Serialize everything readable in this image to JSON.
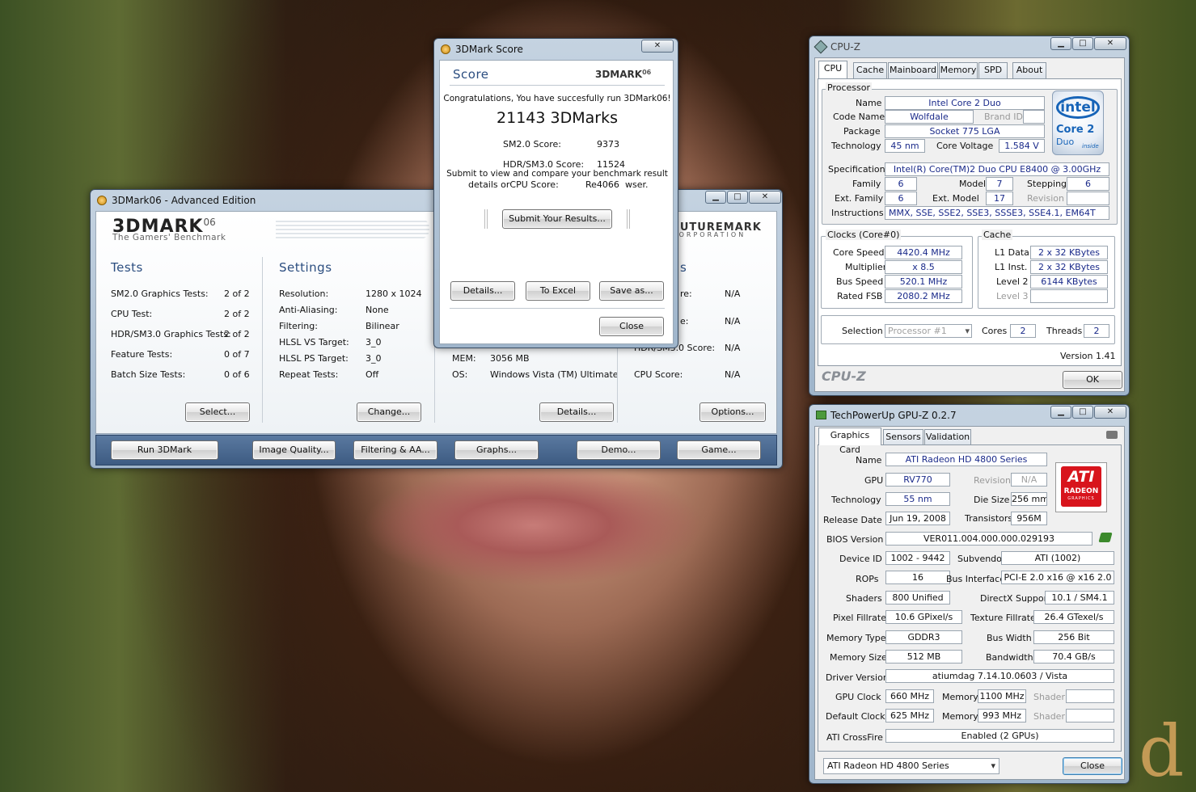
{
  "desktop": {
    "watermark": "d"
  },
  "mark3d": {
    "title": "3DMark06 - Advanced Edition",
    "logo": "3DMARK",
    "logo_sup": "06",
    "tagline": "The Gamers' Benchmark",
    "brand": "FUTUREMARK",
    "brand_sub": "CORPORATION",
    "tests": {
      "heading": "Tests",
      "rows": [
        {
          "label": "SM2.0 Graphics Tests:",
          "value": "2 of 2"
        },
        {
          "label": "CPU Test:",
          "value": "2 of 2"
        },
        {
          "label": "HDR/SM3.0 Graphics Tests:",
          "value": "2 of 2"
        },
        {
          "label": "Feature Tests:",
          "value": "0 of 7"
        },
        {
          "label": "Batch Size Tests:",
          "value": "0 of 6"
        }
      ],
      "button": "Select..."
    },
    "settings": {
      "heading": "Settings",
      "rows": [
        {
          "label": "Resolution:",
          "value": "1280 x 1024"
        },
        {
          "label": "Anti-Aliasing:",
          "value": "None"
        },
        {
          "label": "Filtering:",
          "value": "Bilinear"
        },
        {
          "label": "HLSL VS Target:",
          "value": "3_0"
        },
        {
          "label": "HLSL PS Target:",
          "value": "3_0"
        },
        {
          "label": "Repeat Tests:",
          "value": "Off"
        }
      ],
      "button": "Change..."
    },
    "system": {
      "rows": [
        {
          "label": "MEM:",
          "value": "3056 MB"
        },
        {
          "label": "OS:",
          "value": "Windows Vista (TM) Ultimate"
        }
      ],
      "button": "Details..."
    },
    "results": {
      "heading_suffix": "s",
      "rows": [
        {
          "label": "re:",
          "value": "N/A"
        },
        {
          "label": "e:",
          "value": "N/A"
        },
        {
          "label": "HDR/SM3.0 Score:",
          "value": "N/A"
        },
        {
          "label": "CPU Score:",
          "value": "N/A"
        }
      ],
      "button": "Options..."
    },
    "bottom": [
      "Run 3DMark",
      "Image Quality...",
      "Filtering & AA...",
      "Graphs...",
      "Demo...",
      "Game..."
    ]
  },
  "score": {
    "title": "3DMark Score",
    "heading": "Score",
    "logo": "3DMARK",
    "logo_sup": "06",
    "congrats": "Congratulations, You have succesfully run 3DMark06!",
    "total": "21143 3DMarks",
    "sm2_label": "SM2.0 Score:",
    "sm2_value": "9373",
    "hdr_label": "HDR/SM3.0 Score:",
    "hdr_value": "11524",
    "submit_line1": "Submit to view and compare your benchmark result",
    "submit_line2_a": "details orCPU Score:",
    "submit_line2_b": "Re4066",
    "submit_line2_c": "wser.",
    "submit_btn": "Submit Your Results...",
    "details_btn": "Details...",
    "excel_btn": "To Excel",
    "saveas_btn": "Save as...",
    "close_btn": "Close"
  },
  "cpuz": {
    "title": "CPU-Z",
    "tabs": [
      "CPU",
      "Cache",
      "Mainboard",
      "Memory",
      "SPD",
      "About"
    ],
    "processor_title": "Processor",
    "name_label": "Name",
    "name": "Intel Core 2 Duo",
    "codename_label": "Code Name",
    "codename": "Wolfdale",
    "brandid_label": "Brand ID",
    "package_label": "Package",
    "package": "Socket 775 LGA",
    "tech_label": "Technology",
    "tech": "45 nm",
    "voltage_label": "Core Voltage",
    "voltage": "1.584 V",
    "spec_label": "Specification",
    "spec": "Intel(R) Core(TM)2 Duo CPU    E8400  @ 3.00GHz",
    "family_label": "Family",
    "family": "6",
    "model_label": "Model",
    "model": "7",
    "stepping_label": "Stepping",
    "stepping": "6",
    "extfamily_label": "Ext. Family",
    "extfamily": "6",
    "extmodel_label": "Ext. Model",
    "extmodel": "17",
    "revision_label": "Revision",
    "instr_label": "Instructions",
    "instr": "MMX, SSE, SSE2, SSE3, SSSE3, SSE4.1, EM64T",
    "logo_intel": "intel",
    "logo_core": "Core 2",
    "logo_duo": "Duo",
    "logo_inside": "inside",
    "clocks_title": "Clocks (Core#0)",
    "corespeed_label": "Core Speed",
    "corespeed": "4420.4 MHz",
    "mult_label": "Multiplier",
    "mult": "x 8.5",
    "bus_label": "Bus Speed",
    "bus": "520.1 MHz",
    "fsb_label": "Rated FSB",
    "fsb": "2080.2 MHz",
    "cache_title": "Cache",
    "l1d_label": "L1 Data",
    "l1d": "2 x 32 KBytes",
    "l1i_label": "L1 Inst.",
    "l1i": "2 x 32 KBytes",
    "l2_label": "Level 2",
    "l2": "6144 KBytes",
    "l3_label": "Level 3",
    "selection_label": "Selection",
    "selection": "Processor #1",
    "cores_label": "Cores",
    "cores": "2",
    "threads_label": "Threads",
    "threads": "2",
    "version": "Version 1.41",
    "footer_logo": "CPU-Z",
    "ok": "OK"
  },
  "gpuz": {
    "title": "TechPowerUp GPU-Z 0.2.7",
    "tabs": [
      "Graphics Card",
      "Sensors",
      "Validation"
    ],
    "name_label": "Name",
    "name": "ATI Radeon HD 4800 Series",
    "gpu_label": "GPU",
    "gpu": "RV770",
    "revision_label": "Revision",
    "revision": "N/A",
    "tech_label": "Technology",
    "tech": "55 nm",
    "die_label": "Die Size",
    "die": "256 mm²",
    "release_label": "Release Date",
    "release": "Jun 19, 2008",
    "trans_label": "Transistors",
    "trans": "956M",
    "bios_label": "BIOS Version",
    "bios": "VER011.004.000.000.029193",
    "device_label": "Device ID",
    "device": "1002 - 9442",
    "subvendor_label": "Subvendor",
    "subvendor": "ATI (1002)",
    "rops_label": "ROPs",
    "rops": "16",
    "busif_label": "Bus Interface",
    "busif": "PCI-E 2.0 x16 @ x16 2.0",
    "shaders_label": "Shaders",
    "shaders": "800 Unified",
    "dx_label": "DirectX Support",
    "dx": "10.1 / SM4.1",
    "pix_label": "Pixel Fillrate",
    "pix": "10.6 GPixel/s",
    "tex_label": "Texture Fillrate",
    "tex": "26.4 GTexel/s",
    "memtype_label": "Memory Type",
    "memtype": "GDDR3",
    "buswidth_label": "Bus Width",
    "buswidth": "256 Bit",
    "memsize_label": "Memory Size",
    "memsize": "512 MB",
    "bandwidth_label": "Bandwidth",
    "bandwidth": "70.4 GB/s",
    "driver_label": "Driver Version",
    "driver": "atiumdag 7.14.10.0603  / Vista",
    "gpuclock_label": "GPU Clock",
    "gpuclock": "660 MHz",
    "mem_label": "Memory",
    "memclock": "1100 MHz",
    "shader_label": "Shader",
    "defclock_label": "Default Clock",
    "defclock": "625 MHz",
    "defmem": "993 MHz",
    "crossfire_label": "ATI CrossFire",
    "crossfire": "Enabled (2 GPUs)",
    "selected_card": "ATI Radeon HD 4800 Series",
    "close": "Close",
    "logo_ati": "ATI",
    "logo_radeon": "RADEON",
    "logo_graphics": "GRAPHICS"
  }
}
